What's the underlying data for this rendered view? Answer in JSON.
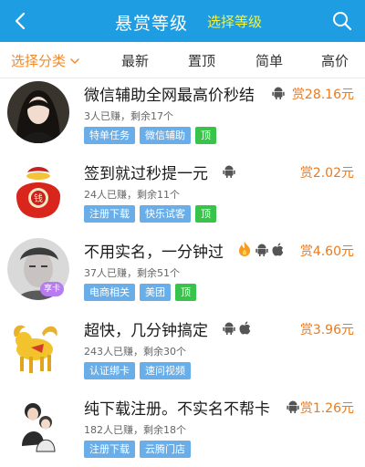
{
  "header": {
    "title": "悬赏等级",
    "level_link": "选择等级"
  },
  "filters": {
    "category": "选择分类",
    "newest": "最新",
    "top": "置顶",
    "simple": "简单",
    "highest": "高价"
  },
  "colors": {
    "header_bg": "#1e9de3",
    "accent": "#f08a2c",
    "reward": "#ec7a1c",
    "tag_blue": "#69aee8",
    "tag_green": "#38c44a"
  },
  "tasks": [
    {
      "title": "微信辅助全网最高价秒结",
      "platforms": [
        "android-icon"
      ],
      "reward": "赏28.16元",
      "stats": "3人已赚，剩余17个",
      "tags": [
        "特单任务",
        "微信辅助",
        "顶"
      ]
    },
    {
      "title": "签到就过秒提一元",
      "platforms": [
        "android-icon"
      ],
      "reward": "赏2.02元",
      "stats": "24人已赚，剩余11个",
      "tags": [
        "注册下载",
        "快乐试客",
        "顶"
      ]
    },
    {
      "title": "不用实名，一分钟过",
      "platforms": [
        "fire-icon",
        "android-icon",
        "apple-icon"
      ],
      "reward": "赏4.60元",
      "stats": "37人已赚，剩余51个",
      "tags": [
        "电商相关",
        "美团",
        "顶"
      ],
      "avatar_badge": "享卡"
    },
    {
      "title": "超快，几分钟搞定",
      "platforms": [
        "android-icon",
        "apple-icon"
      ],
      "reward": "赏3.96元",
      "stats": "243人已赚，剩余30个",
      "tags": [
        "认证绑卡",
        "速问视频"
      ]
    },
    {
      "title": "纯下载注册。不实名不帮卡",
      "platforms": [
        "android-icon"
      ],
      "reward": "赏1.26元",
      "stats": "182人已赚，剩余18个",
      "tags": [
        "注册下载",
        "云腾门店"
      ]
    }
  ]
}
